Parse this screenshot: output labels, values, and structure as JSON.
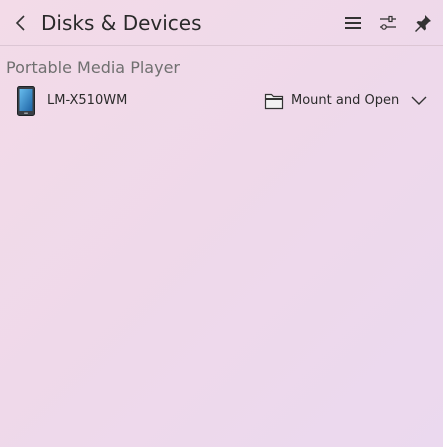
{
  "header": {
    "title": "Disks & Devices",
    "back_icon": "chevron-left-icon",
    "menu_icon": "hamburger-menu-icon",
    "settings_icon": "configure-sliders-icon",
    "pin_icon": "pin-icon"
  },
  "section": {
    "title": "Portable Media Player"
  },
  "device": {
    "name": "LM-X510WM",
    "icon": "phone-device-icon",
    "action_icon": "folder-icon",
    "action_label": "Mount and Open",
    "expand_icon": "chevron-down-icon"
  },
  "colors": {
    "background_start": "#f3dbe8",
    "background_end": "#ebd9ef",
    "text": "#2b2b2b",
    "section_text": "#707070"
  }
}
